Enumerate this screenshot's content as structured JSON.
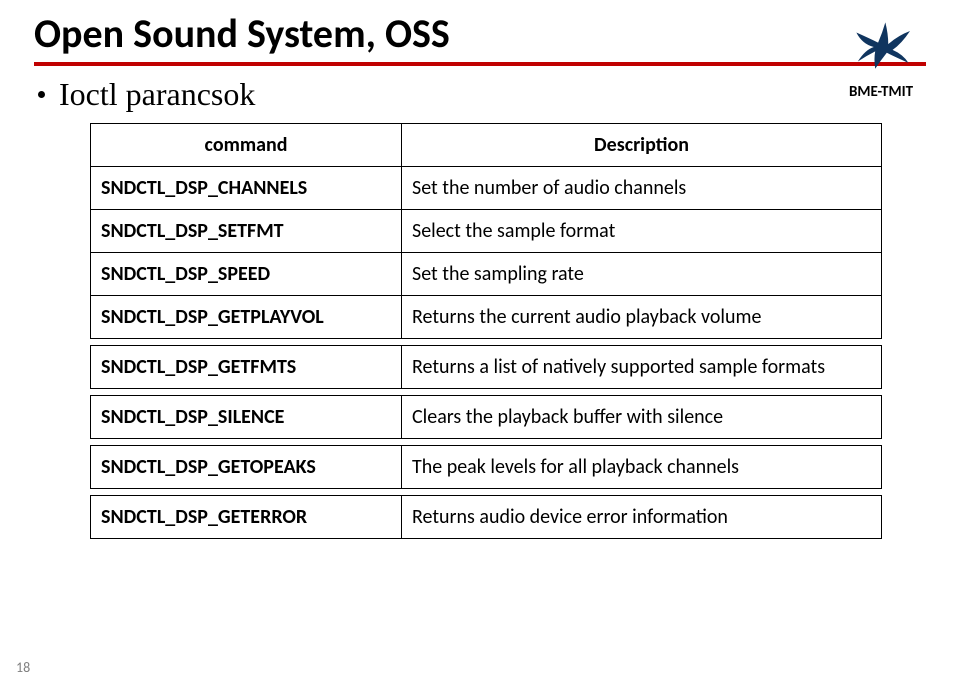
{
  "title": "Open Sound System, OSS",
  "logo_text": "BME-TMIT",
  "bullet": "Ioctl parancsok",
  "table_headers": {
    "command": "command",
    "description": "Description"
  },
  "groups": [
    {
      "rows": [
        {
          "cmd": "SNDCTL_DSP_CHANNELS",
          "desc": "Set the number of audio channels"
        },
        {
          "cmd": "SNDCTL_DSP_SETFMT",
          "desc": "Select the sample format"
        },
        {
          "cmd": "SNDCTL_DSP_SPEED",
          "desc": "Set the sampling rate"
        },
        {
          "cmd": "SNDCTL_DSP_GETPLAYVOL",
          "desc": "Returns the current audio playback volume"
        }
      ]
    },
    {
      "rows": [
        {
          "cmd": "SNDCTL_DSP_GETFMTS",
          "desc": "Returns a list of natively supported sample formats"
        }
      ]
    },
    {
      "rows": [
        {
          "cmd": "SNDCTL_DSP_SILENCE",
          "desc": "Clears the playback buffer with silence"
        }
      ]
    },
    {
      "rows": [
        {
          "cmd": "SNDCTL_DSP_GETOPEAKS",
          "desc": "The peak levels for all playback channels"
        }
      ]
    },
    {
      "rows": [
        {
          "cmd": "SNDCTL_DSP_GETERROR",
          "desc": "Returns audio device error information"
        }
      ]
    }
  ],
  "page_number": "18"
}
